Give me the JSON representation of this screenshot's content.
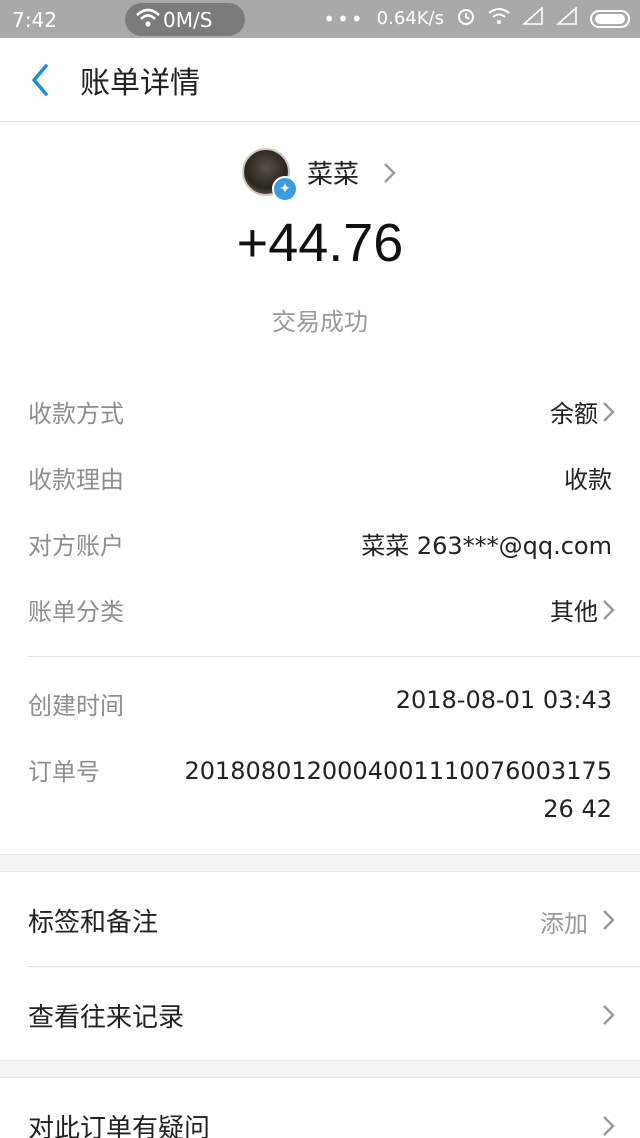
{
  "status_bar": {
    "time": "7:42",
    "speed_pill": "0M/S",
    "net_speed": "0.64K/s"
  },
  "header": {
    "title": "账单详情"
  },
  "summary": {
    "user_name": "菜菜",
    "amount": "+44.76",
    "status": "交易成功"
  },
  "details": {
    "method_label": "收款方式",
    "method_value": "余额",
    "reason_label": "收款理由",
    "reason_value": "收款",
    "counterparty_label": "对方账户",
    "counterparty_value": "菜菜 263***@qq.com",
    "category_label": "账单分类",
    "category_value": "其他",
    "created_label": "创建时间",
    "created_value": "2018-08-01 03:43",
    "order_label": "订单号",
    "order_value": "2018080120004001110076003175 26 42"
  },
  "menu": {
    "tags_label": "标签和备注",
    "tags_action": "添加",
    "history_label": "查看往来记录",
    "question_label": "对此订单有疑问"
  },
  "colors": {
    "accent": "#1a8fd6",
    "muted": "#8e8e8e",
    "divider": "#e2e2e2"
  }
}
